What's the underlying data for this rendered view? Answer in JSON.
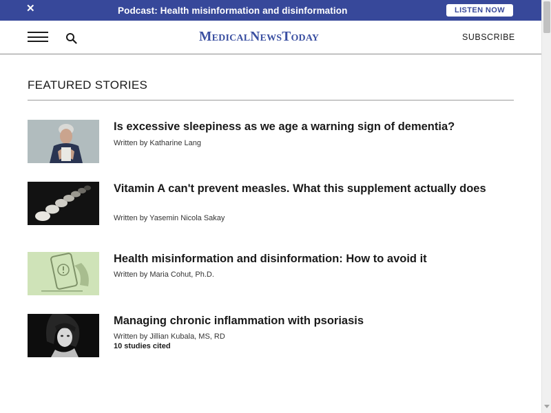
{
  "banner": {
    "close_label": "✕",
    "text": "Podcast: Health misinformation and disinformation",
    "button_label": "LISTEN NOW"
  },
  "header": {
    "logo": "MedicalNewsToday",
    "subscribe_label": "SUBSCRIBE"
  },
  "featured": {
    "title": "FEATURED STORIES",
    "stories": [
      {
        "headline": "Is excessive sleepiness as we age a warning sign of dementia?",
        "byline": "Written by Katharine Lang"
      },
      {
        "headline": "Vitamin A can't prevent measles. What this supplement actually does",
        "byline": "Written by Yasemin Nicola Sakay"
      },
      {
        "headline": "Health misinformation and disinformation: How to avoid it",
        "byline": "Written by Maria Cohut, Ph.D."
      },
      {
        "headline": "Managing chronic inflammation with psoriasis",
        "byline": "Written by Jillian Kubala, MS, RD",
        "extra": "10 studies cited"
      }
    ]
  },
  "colors": {
    "brand": "#37489a",
    "logo": "#3a4fa1",
    "text": "#1a1a1a"
  }
}
